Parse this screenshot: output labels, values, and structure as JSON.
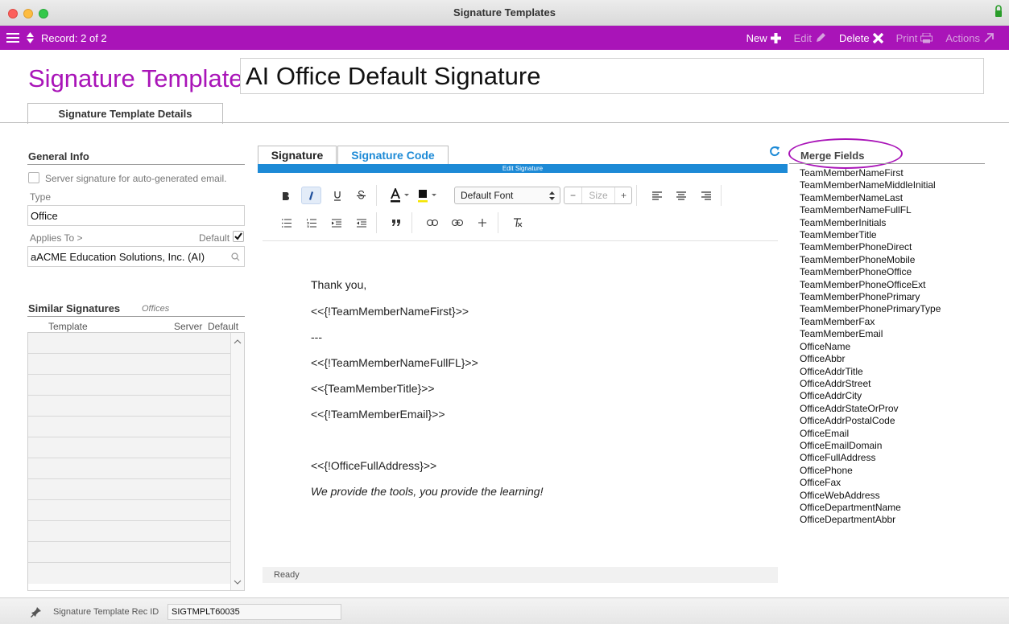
{
  "window": {
    "title": "Signature Templates"
  },
  "toolbar": {
    "record": "Record: 2 of 2",
    "new_label": "New",
    "edit_label": "Edit",
    "delete_label": "Delete",
    "print_label": "Print",
    "actions_label": "Actions",
    "accent": "#a914b8"
  },
  "header": {
    "label": "Signature Template:",
    "name": "AI Office Default Signature"
  },
  "main_tab": "Signature Template Details",
  "general_info": {
    "heading": "General Info",
    "server_checkbox_label": "Server signature for auto-generated email.",
    "type_label": "Type",
    "type_value": "Office",
    "applies_label": "Applies To >",
    "default_label": "Default",
    "applies_value": "aACME Education Solutions, Inc. (AI)"
  },
  "similar": {
    "heading": "Similar Signatures",
    "subheading": "Offices",
    "col_template": "Template",
    "col_server": "Server",
    "col_default": "Default"
  },
  "editor": {
    "tab_signature": "Signature",
    "tab_code": "Signature Code",
    "bar_label": "Edit Signature",
    "font": "Default Font",
    "size_placeholder": "Size",
    "status": "Ready",
    "lines": [
      "Thank you,",
      "<<{!TeamMemberNameFirst}>>",
      "---",
      "<<{!TeamMemberNameFullFL}>>",
      "<<{TeamMemberTitle}>>",
      "<<{!TeamMemberEmail}>>",
      "<<{!OfficeFullAddress}>>",
      "We provide the tools, you provide the learning!"
    ]
  },
  "merge": {
    "heading": "Merge Fields",
    "fields": [
      "TeamMemberNameFirst",
      "TeamMemberNameMiddleInitial",
      "TeamMemberNameLast",
      "TeamMemberNameFullFL",
      "TeamMemberInitials",
      "TeamMemberTitle",
      "TeamMemberPhoneDirect",
      "TeamMemberPhoneMobile",
      "TeamMemberPhoneOffice",
      "TeamMemberPhoneOfficeExt",
      "TeamMemberPhonePrimary",
      "TeamMemberPhonePrimaryType",
      "TeamMemberFax",
      "TeamMemberEmail",
      "OfficeName",
      "OfficeAbbr",
      "OfficeAddrTitle",
      "OfficeAddrStreet",
      "OfficeAddrCity",
      "OfficeAddrStateOrProv",
      "OfficeAddrPostalCode",
      "OfficeEmail",
      "OfficeEmailDomain",
      "OfficeFullAddress",
      "OfficePhone",
      "OfficeFax",
      "OfficeWebAddress",
      "OfficeDepartmentName",
      "OfficeDepartmentAbbr"
    ]
  },
  "footer": {
    "label": "Signature Template Rec ID",
    "value": "SIGTMPLT60035"
  }
}
